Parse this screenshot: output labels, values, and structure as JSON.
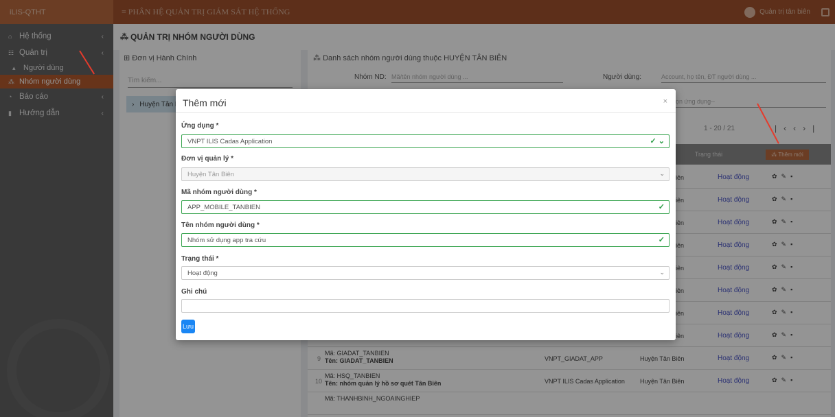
{
  "topbar": {
    "brand": "iLIS-QTHT",
    "title": "≡ PHÂN HỆ QUẢN TRỊ GIÁM SÁT HỆ THỐNG",
    "user": "Quản trị tân biên"
  },
  "sidebar": {
    "items": [
      {
        "label": "Hệ thống",
        "icon": "home-icon"
      },
      {
        "label": "Quản trị",
        "icon": "users-icon"
      },
      {
        "label": "Người dùng",
        "icon": "user-icon"
      },
      {
        "label": "Nhóm người dùng",
        "icon": "group-icon"
      },
      {
        "label": "Báo cáo",
        "icon": "chart-icon"
      },
      {
        "label": "Hướng dẫn",
        "icon": "book-icon"
      }
    ]
  },
  "page": {
    "title": "QUẢN TRỊ NHÓM NGƯỜI DÙNG",
    "left_panel_title": "Đơn vị Hành Chính",
    "search_placeholder": "Tìm kiếm...",
    "tree_node": "Huyện Tân B",
    "right_panel_title": "Danh sách nhóm người dùng thuộc HUYỆN TÂN BIÊN",
    "filter_group_label": "Nhóm ND:",
    "filter_group_placeholder": "Mã/tên nhóm người dùng ...",
    "filter_user_label": "Người dùng:",
    "filter_user_placeholder": "Account, họ tên, ĐT người dùng ...",
    "filter_app_placeholder": "ọn ứng dụng--",
    "pager_range": "1 - 20 / 21",
    "col_status": "Trạng thái",
    "add_button": "Thêm mới"
  },
  "rows": [
    {
      "num": "",
      "code": "",
      "name": "",
      "app": "",
      "unit": "iên",
      "status": "Hoạt động"
    },
    {
      "num": "",
      "code": "",
      "name": "",
      "app": "",
      "unit": "iên",
      "status": "Hoạt động"
    },
    {
      "num": "",
      "code": "",
      "name": "",
      "app": "",
      "unit": "iên",
      "status": "Hoạt động"
    },
    {
      "num": "",
      "code": "",
      "name": "",
      "app": "",
      "unit": "iên",
      "status": "Hoạt động"
    },
    {
      "num": "",
      "code": "",
      "name": "",
      "app": "",
      "unit": "iên",
      "status": "Hoạt động"
    },
    {
      "num": "",
      "code": "",
      "name": "",
      "app": "",
      "unit": "iên",
      "status": "Hoạt động"
    },
    {
      "num": "",
      "code": "",
      "name": "",
      "app": "",
      "unit": "iên",
      "status": "Hoạt động"
    },
    {
      "num": "",
      "code": "",
      "name": "",
      "app": "",
      "unit": "iên",
      "status": "Hoạt động"
    },
    {
      "num": "9",
      "code": "Mã: GIADAT_TANBIEN",
      "name": "Tên: GIADAT_TANBIEN",
      "app": "VNPT_GIADAT_APP",
      "unit": "Huyện Tân Biên",
      "status": "Hoạt động"
    },
    {
      "num": "10",
      "code": "Mã: HSQ_TANBIEN",
      "name": "Tên: nhóm quản lý hồ sơ quét Tân Biên",
      "app": "VNPT ILIS Cadas Application",
      "unit": "Huyện Tân Biên",
      "status": "Hoạt động"
    },
    {
      "num": "",
      "code": "Mã: THANHBINH_NGOAINGHIEP",
      "name": "",
      "app": "",
      "unit": "",
      "status": ""
    }
  ],
  "modal": {
    "title": "Thêm mới",
    "close": "×",
    "fields": {
      "app_label": "Ứng dụng *",
      "app_value": "VNPT ILIS Cadas Application",
      "unit_label": "Đơn vị quản lý *",
      "unit_value": "Huyện Tân Biên",
      "code_label": "Mã nhóm người dùng *",
      "code_value": "APP_MOBILE_TANBIEN",
      "name_label": "Tên nhóm người dùng *",
      "name_value": "Nhóm sử dụng app tra cứu",
      "status_label": "Trạng thái *",
      "status_value": "Hoạt động",
      "note_label": "Ghi chú",
      "note_value": ""
    },
    "save_label": "Lưu"
  },
  "colors": {
    "accent": "#a0522d",
    "valid": "#38a44f",
    "primary": "#1a86f4",
    "link": "#4a55c7"
  }
}
